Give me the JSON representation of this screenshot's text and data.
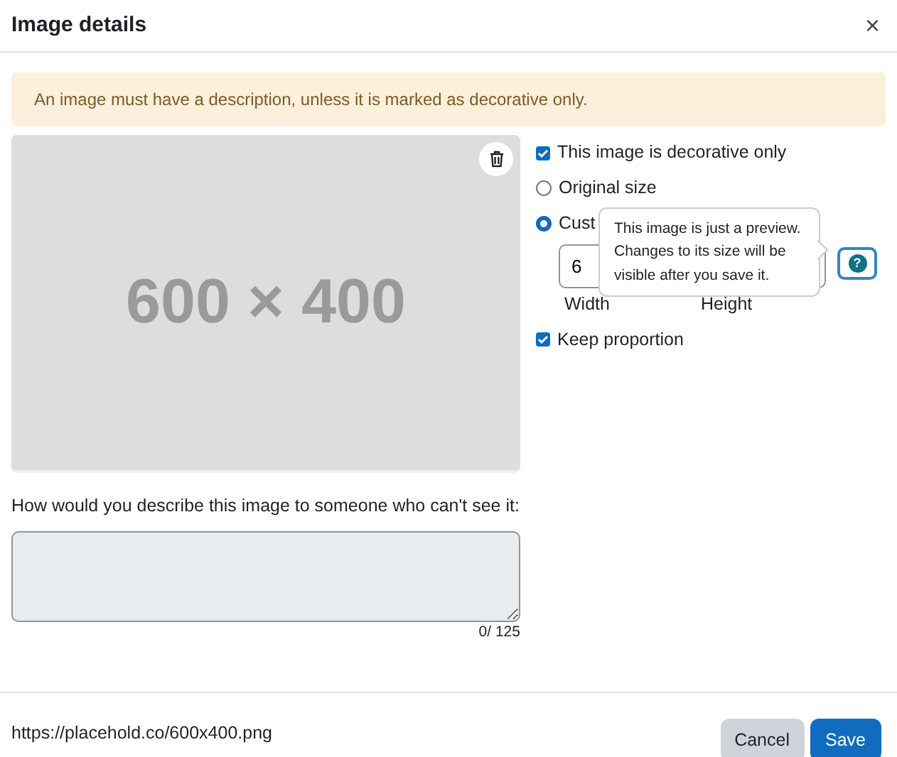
{
  "dialog": {
    "title": "Image details",
    "close": "×"
  },
  "alert": {
    "text": "An image must have a description, unless it is marked as decorative only."
  },
  "preview": {
    "text": "600 × 400"
  },
  "options": [
    {
      "kind": "checkbox",
      "label": "This image is decorative only",
      "checked": true
    },
    {
      "kind": "radio",
      "label": "Original size",
      "selected": false
    },
    {
      "kind": "radio",
      "label": "Cust",
      "selected": true
    }
  ],
  "size": {
    "width_value": "6",
    "help": "?",
    "width_label": "Width",
    "height_label": "Height"
  },
  "keep_proportion": {
    "label": "Keep proportion",
    "checked": true
  },
  "tooltip": {
    "text": "This image is just a preview. Changes to its size will be visible after you save it."
  },
  "description": {
    "label": "How would you describe this image to someone who can't see it:",
    "counter": "0/ 125"
  },
  "footer": {
    "url": "https://placehold.co/600x400.png",
    "buttons": [
      {
        "label": "Cancel",
        "kind": "secondary"
      },
      {
        "label": "Save",
        "kind": "primary"
      }
    ]
  }
}
